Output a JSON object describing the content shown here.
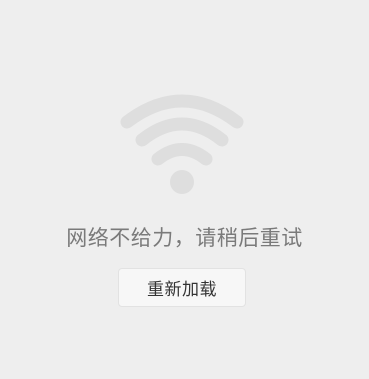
{
  "error": {
    "icon": "wifi-icon",
    "icon_color": "#dedede",
    "message": "网络不给力，请稍后重试",
    "reload_label": "重新加载"
  },
  "colors": {
    "background": "#eeeeee",
    "message_text": "#7a7a7a",
    "button_background": "#f7f7f7",
    "button_text": "#333333"
  }
}
